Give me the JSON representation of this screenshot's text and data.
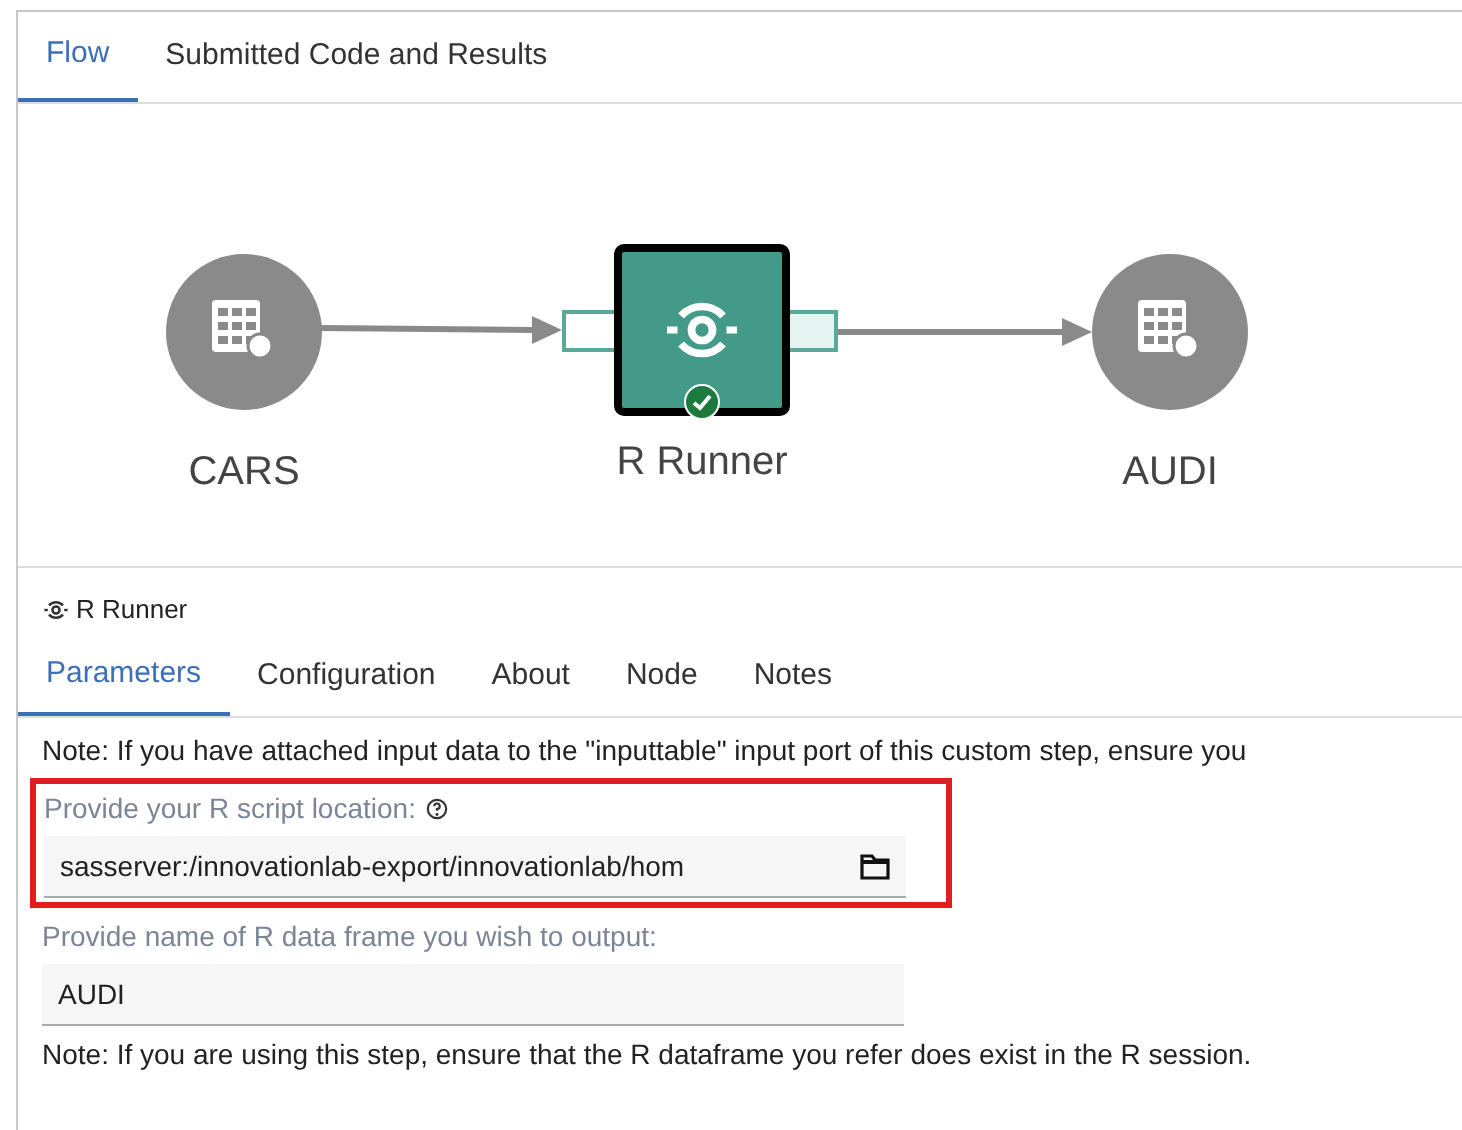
{
  "tabs": [
    {
      "label": "Flow",
      "selected": true
    },
    {
      "label": "Submitted Code and Results",
      "selected": false
    }
  ],
  "flow": {
    "nodes": [
      {
        "kind": "table",
        "label": "CARS"
      },
      {
        "kind": "step",
        "label": "R Runner",
        "selected": true,
        "succeeded": true
      },
      {
        "kind": "table",
        "label": "AUDI"
      }
    ]
  },
  "panel": {
    "title": "R Runner",
    "tabs": [
      {
        "label": "Parameters",
        "selected": true
      },
      {
        "label": "Configuration",
        "selected": false
      },
      {
        "label": "About",
        "selected": false
      },
      {
        "label": "Node",
        "selected": false
      },
      {
        "label": "Notes",
        "selected": false
      }
    ],
    "items": [
      {
        "kind": "note",
        "text": "Note: If you have attached input data to the \"inputtable\" input port of this custom step, ensure you"
      },
      {
        "kind": "file",
        "label": "Provide your R script location:",
        "value": "sasserver:/innovationlab-export/innovationlab/hom",
        "highlighted": true
      },
      {
        "kind": "text",
        "label": "Provide name of R data frame you wish to output:",
        "value": "AUDI",
        "highlighted": false
      },
      {
        "kind": "note",
        "text": "Note: If you are using this step, ensure that the R dataframe you refer does exist in the R session."
      }
    ]
  }
}
